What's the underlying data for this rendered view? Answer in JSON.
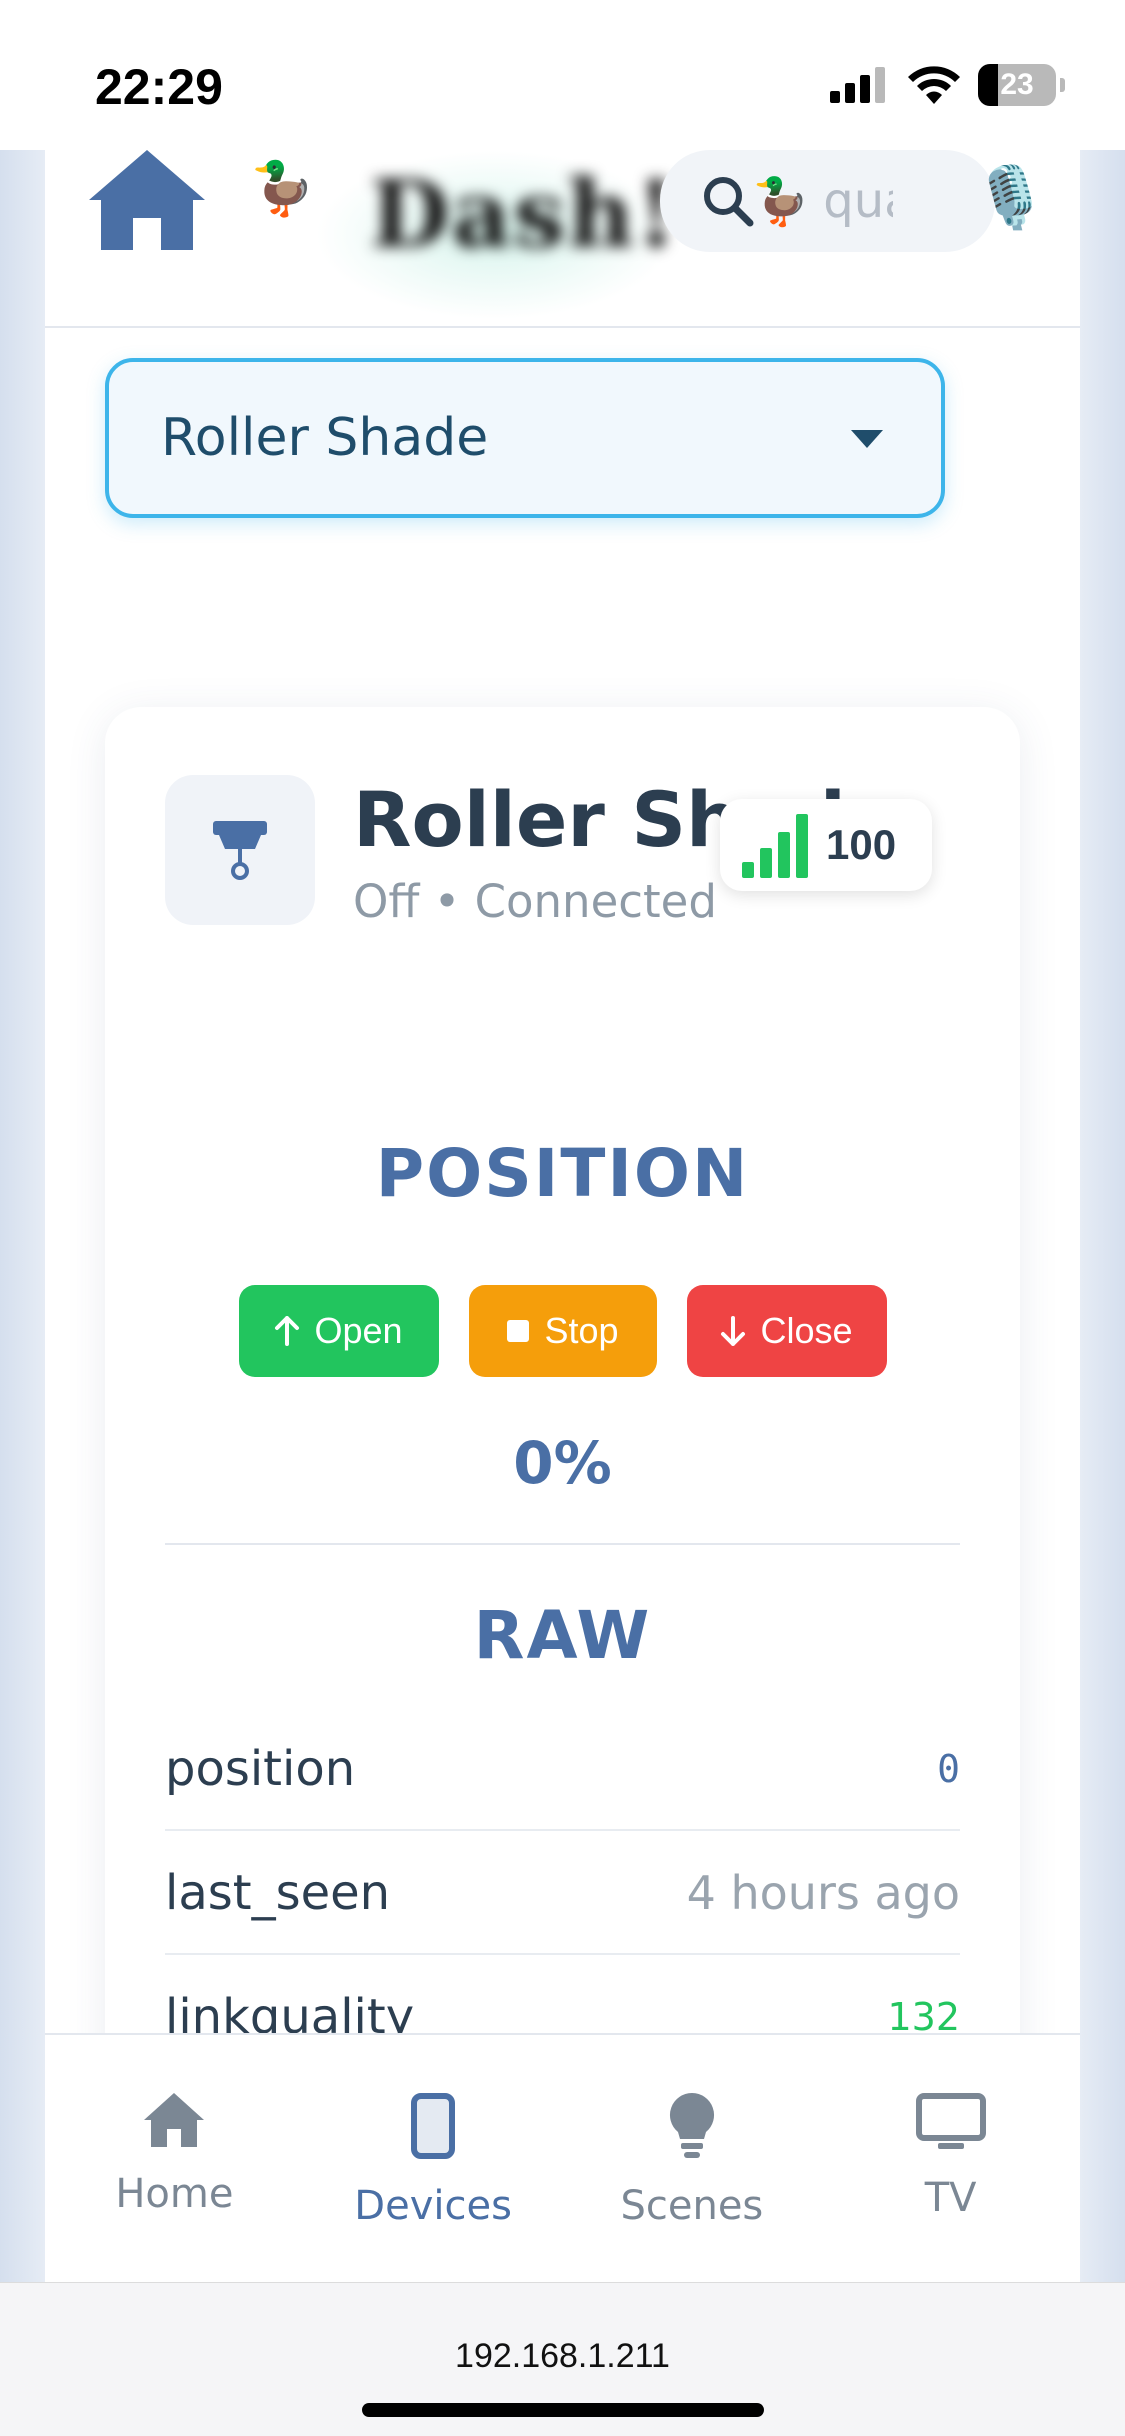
{
  "status_bar": {
    "time": "22:29",
    "battery": "23"
  },
  "header": {
    "brand": "Dash!",
    "search_placeholder": "qua"
  },
  "device_select": {
    "selected": "Roller Shade"
  },
  "device": {
    "name": "Roller Shade",
    "status": "Off • Connected",
    "signal": "100"
  },
  "position": {
    "title": "POSITION",
    "open_label": "Open",
    "stop_label": "Stop",
    "close_label": "Close",
    "value": "0%"
  },
  "raw": {
    "title": "RAW",
    "rows": [
      {
        "key": "position",
        "value": "0"
      },
      {
        "key": "last_seen",
        "value": "4 hours ago"
      },
      {
        "key": "linkquality",
        "value": "132"
      }
    ]
  },
  "nav": {
    "items": [
      {
        "label": "Home",
        "icon": "home-icon"
      },
      {
        "label": "Devices",
        "icon": "phone-icon"
      },
      {
        "label": "Scenes",
        "icon": "bulb-icon"
      },
      {
        "label": "TV",
        "icon": "tv-icon"
      }
    ],
    "active": "Devices"
  },
  "browser": {
    "url": "192.168.1.211"
  },
  "colors": {
    "accent": "#4a6fa5",
    "select_border": "#3db5ea",
    "open": "#22c55e",
    "stop": "#f59e0b",
    "close": "#ef4444"
  }
}
